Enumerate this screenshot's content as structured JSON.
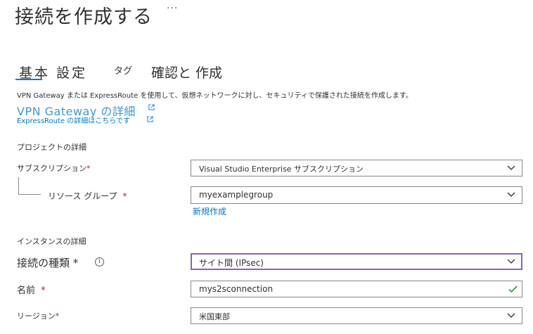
{
  "page": {
    "title": "接続を作成する",
    "more": "···"
  },
  "tabs": {
    "basic": "基本 設定",
    "tag": "タグ",
    "review": "確認と 作成"
  },
  "intro": {
    "description": "VPN Gateway または ExpressRoute を使用して、仮想ネットワークに対し、セキュリティで保護された接続を作成します。",
    "vpn_link": "VPN Gateway の詳細",
    "expressroute_link": "ExpressRoute の詳細はこちらです"
  },
  "project": {
    "heading": "プロジェクトの詳細",
    "subscription_label": "サブスクリプション",
    "subscription_value": "Visual Studio Enterprise サブスクリプション",
    "resource_group_label": "リソース グループ",
    "resource_group_value": "myexamplegroup",
    "create_new": "新規作成"
  },
  "instance": {
    "heading": "インスタンスの詳細",
    "connection_type_label": "接続の種類",
    "connection_type_value": "サイト間 (IPsec)",
    "name_label": "名前",
    "name_value": "mys2sconnection",
    "region_label": "リージョン",
    "region_value": "米国東部"
  },
  "required_mark": "*",
  "info_glyph": "i",
  "icons": {
    "more": "ellipsis-icon",
    "external": "external-link-icon",
    "chevron": "chevron-down-icon",
    "check": "checkmark-icon",
    "info": "info-icon"
  },
  "colors": {
    "accent": "#0078d4",
    "required": "#a4262c",
    "focus_border": "#8764b8",
    "valid_check": "#107c10"
  }
}
